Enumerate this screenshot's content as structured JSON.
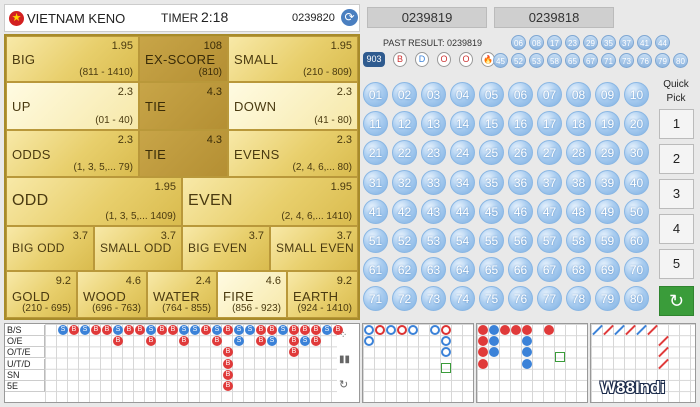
{
  "header": {
    "title": "VIETNAM KENO",
    "timer_label": "TIMER",
    "timer_value": "2:18",
    "draw_id": "0239820"
  },
  "prev_draws": [
    "0239819",
    "0239818"
  ],
  "board": {
    "row1": [
      {
        "name": "BIG",
        "odds": "1.95",
        "range": "(811 - 1410)"
      },
      {
        "name": "EX-SCORE",
        "odds": "108",
        "range": "(810)"
      },
      {
        "name": "SMALL",
        "odds": "1.95",
        "range": "(210 - 809)"
      }
    ],
    "row2": [
      {
        "name": "UP",
        "odds": "2.3",
        "range": "(01 - 40)"
      },
      {
        "name": "TIE",
        "odds": "4.3",
        "range": ""
      },
      {
        "name": "DOWN",
        "odds": "2.3",
        "range": "(41 - 80)"
      }
    ],
    "row3": [
      {
        "name": "ODDS",
        "odds": "2.3",
        "range": "(1, 3, 5,... 79)"
      },
      {
        "name": "TIE",
        "odds": "4.3",
        "range": ""
      },
      {
        "name": "EVENS",
        "odds": "2.3",
        "range": "(2, 4, 6,... 80)"
      }
    ],
    "row4": [
      {
        "name": "ODD",
        "odds": "1.95",
        "range": "(1, 3, 5,... 1409)"
      },
      {
        "name": "EVEN",
        "odds": "1.95",
        "range": "(2, 4, 6,... 1410)"
      }
    ],
    "row5": [
      {
        "name": "BIG ODD",
        "odds": "3.7"
      },
      {
        "name": "SMALL ODD",
        "odds": "3.7"
      },
      {
        "name": "BIG EVEN",
        "odds": "3.7"
      },
      {
        "name": "SMALL EVEN",
        "odds": "3.7"
      }
    ],
    "row6": [
      {
        "name": "GOLD",
        "odds": "9.2",
        "range": "(210 - 695)"
      },
      {
        "name": "WOOD",
        "odds": "4.6",
        "range": "(696 - 763)"
      },
      {
        "name": "WATER",
        "odds": "2.4",
        "range": "(764 - 855)"
      },
      {
        "name": "FIRE",
        "odds": "4.6",
        "range": "(856 - 923)"
      },
      {
        "name": "EARTH",
        "odds": "9.2",
        "range": "(924 - 1410)"
      }
    ]
  },
  "past_result": {
    "label": "PAST RESULT: 0239819",
    "id_badge": "903",
    "badges": [
      "B",
      "D",
      "O",
      "O",
      "🔥"
    ],
    "numbers": [
      "06",
      "08",
      "17",
      "23",
      "29",
      "35",
      "37",
      "41",
      "44",
      "45",
      "52",
      "53",
      "58",
      "65",
      "67",
      "71",
      "73",
      "76",
      "79",
      "80"
    ]
  },
  "numbers": [
    "01",
    "02",
    "03",
    "04",
    "05",
    "06",
    "07",
    "08",
    "09",
    "10",
    "11",
    "12",
    "13",
    "14",
    "15",
    "16",
    "17",
    "18",
    "19",
    "20",
    "21",
    "22",
    "23",
    "24",
    "25",
    "26",
    "27",
    "28",
    "29",
    "30",
    "31",
    "32",
    "33",
    "34",
    "35",
    "36",
    "37",
    "38",
    "39",
    "40",
    "41",
    "42",
    "43",
    "44",
    "45",
    "46",
    "47",
    "48",
    "49",
    "50",
    "51",
    "52",
    "53",
    "54",
    "55",
    "56",
    "57",
    "58",
    "59",
    "60",
    "61",
    "62",
    "63",
    "64",
    "65",
    "66",
    "67",
    "68",
    "69",
    "70",
    "71",
    "72",
    "73",
    "74",
    "75",
    "76",
    "77",
    "78",
    "79",
    "80"
  ],
  "quick_pick": {
    "label_line1": "Quick",
    "label_line2": "Pick",
    "options": [
      "1",
      "2",
      "3",
      "4",
      "5"
    ],
    "go_symbol": "↻"
  },
  "roadmap_labels": [
    "B/S",
    "O/E",
    "O/T/E",
    "U/T/D",
    "SN",
    "5E"
  ],
  "roadmap_letters": {
    "small": "S",
    "big": "B"
  },
  "watermark": "W88Indi",
  "colors": {
    "gold": "#e8cf6c",
    "ball": "#aacdf0",
    "red": "#e03a3a",
    "blue": "#3b82d8",
    "green": "#3a9c3a"
  }
}
